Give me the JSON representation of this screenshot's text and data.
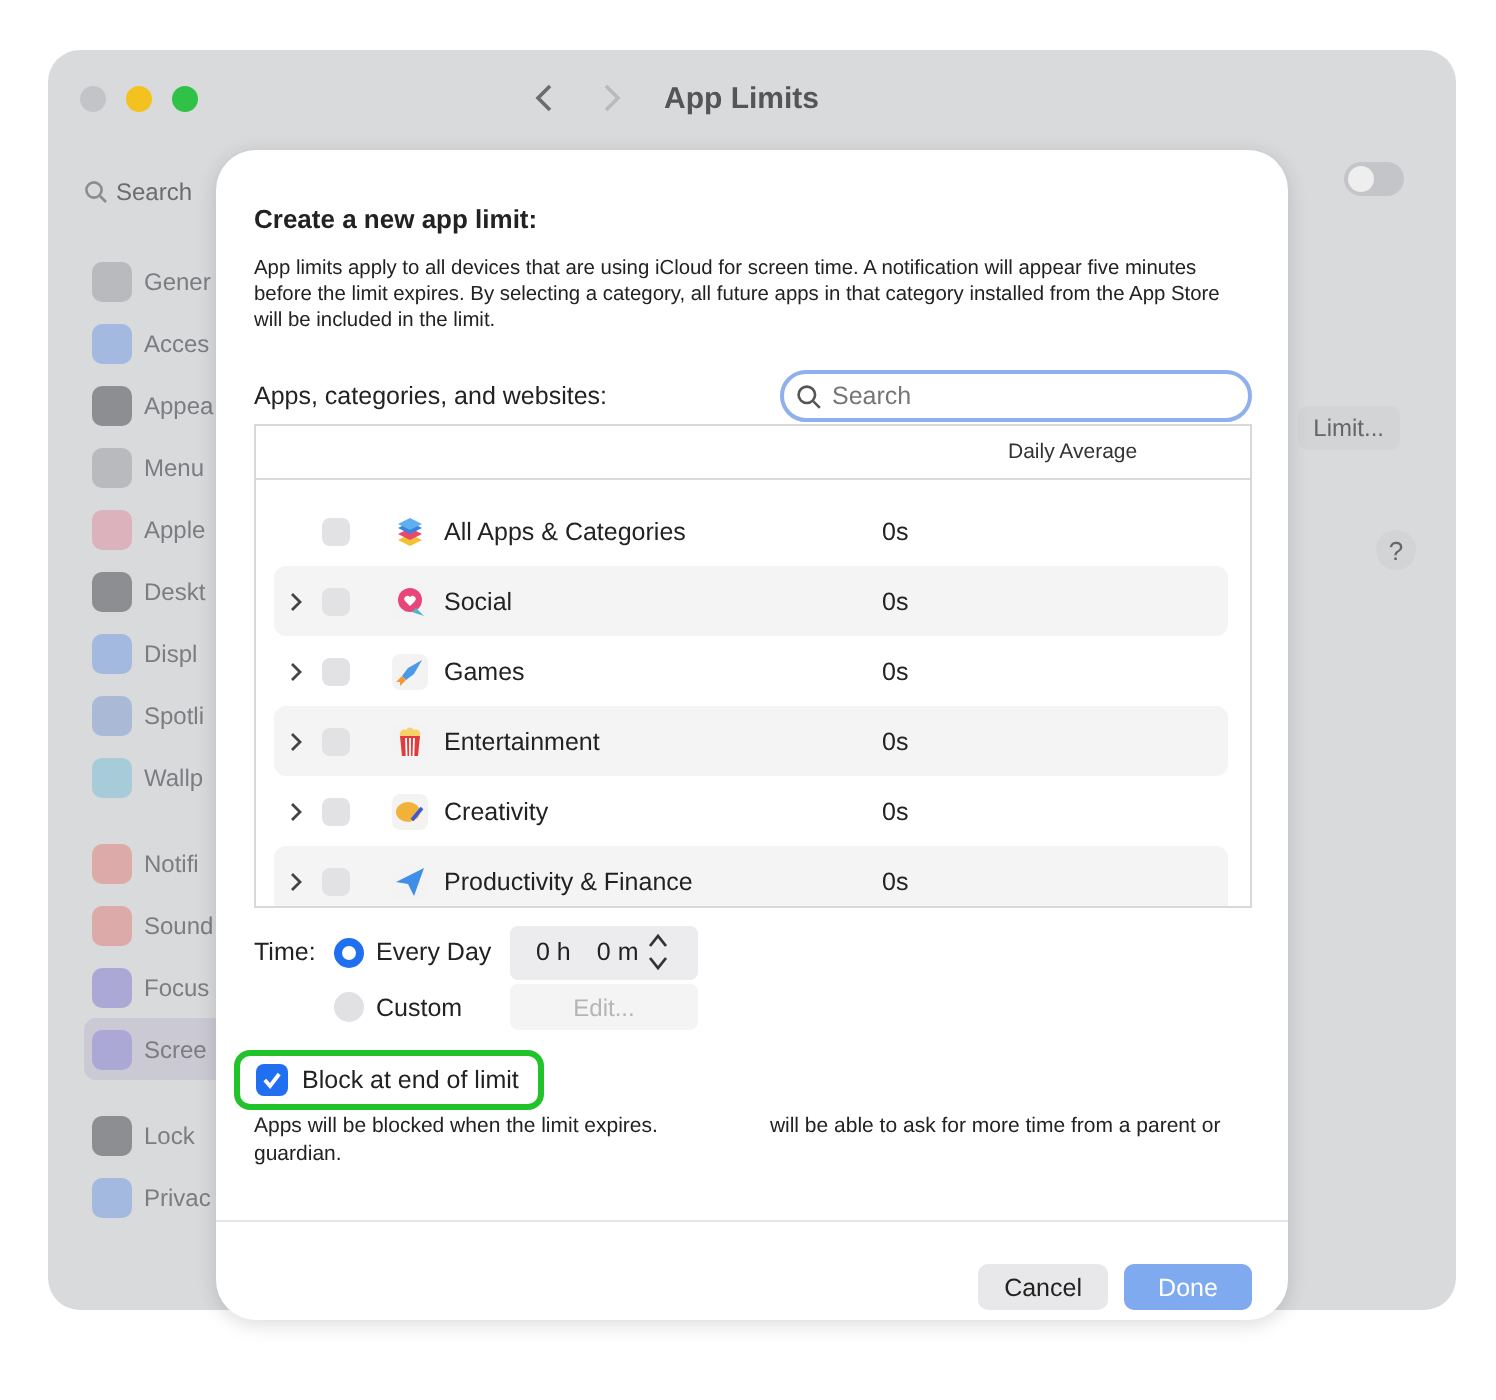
{
  "window": {
    "title": "App Limits",
    "toggle": {
      "on": false
    },
    "limit_button": "Limit...",
    "help": "?"
  },
  "sidebar": {
    "search": {
      "placeholder": "Search"
    },
    "items": [
      {
        "label": "Gener",
        "color": "#b9babd",
        "selected": false
      },
      {
        "label": "Acces",
        "color": "#a3b9e0",
        "selected": false
      },
      {
        "label": "Appea",
        "color": "#8d8e91",
        "selected": false
      },
      {
        "label": "Menu",
        "color": "#b9babd",
        "selected": false
      },
      {
        "label": "Apple",
        "color": "#dcb3bd",
        "selected": false
      },
      {
        "label": "Deskt",
        "color": "#8d8e91",
        "selected": false
      },
      {
        "label": "Displ",
        "color": "#a3b9e0",
        "selected": false
      },
      {
        "label": "Spotli",
        "color": "#a9b9d6",
        "selected": false
      },
      {
        "label": "Wallp",
        "color": "#a8cbd9",
        "selected": false
      },
      {
        "label": "Notifi",
        "color": "#dcaaa8",
        "selected": false
      },
      {
        "label": "Sound",
        "color": "#dcaaa8",
        "selected": false
      },
      {
        "label": "Focus",
        "color": "#aca8d6",
        "selected": false
      },
      {
        "label": "Scree",
        "color": "#aca8d6",
        "selected": true
      },
      {
        "label": "Lock",
        "color": "#8d8e91",
        "selected": false
      },
      {
        "label": "Privac",
        "color": "#a3b9e0",
        "selected": false
      }
    ]
  },
  "dialog": {
    "title": "Create a new app limit:",
    "description": "App limits apply to all devices that are using iCloud for screen time. A notification will appear five minutes before the limit expires. By selecting a category, all future apps in that category installed from the App Store will be included in the limit.",
    "list_label": "Apps, categories, and websites:",
    "search": {
      "placeholder": "Search"
    },
    "table": {
      "columns": [
        "Daily Average"
      ],
      "rows": [
        {
          "name": "All Apps & Categories",
          "average": "0s",
          "kind": "stack",
          "expandable": false,
          "checked": false
        },
        {
          "name": "Social",
          "average": "0s",
          "kind": "social",
          "expandable": true,
          "checked": false
        },
        {
          "name": "Games",
          "average": "0s",
          "kind": "games",
          "expandable": true,
          "checked": false
        },
        {
          "name": "Entertainment",
          "average": "0s",
          "kind": "entertainment",
          "expandable": true,
          "checked": false
        },
        {
          "name": "Creativity",
          "average": "0s",
          "kind": "creativity",
          "expandable": true,
          "checked": false
        },
        {
          "name": "Productivity & Finance",
          "average": "0s",
          "kind": "productivity",
          "expandable": true,
          "checked": false
        }
      ]
    },
    "time": {
      "label": "Time:",
      "options": [
        {
          "label": "Every Day",
          "selected": true
        },
        {
          "label": "Custom",
          "selected": false
        }
      ],
      "hours": "0 h",
      "minutes": "0 m",
      "edit_button": {
        "label": "Edit...",
        "disabled": true
      }
    },
    "block": {
      "label": "Block at end of limit",
      "checked": true,
      "highlighted": true
    },
    "note": {
      "before": "Apps will be blocked when the limit expires.",
      "after": "will be able to ask for more time from a parent or guardian."
    },
    "buttons": [
      {
        "label": "Cancel",
        "kind": "secondary",
        "disabled": false
      },
      {
        "label": "Done",
        "kind": "primary",
        "disabled": true
      }
    ]
  }
}
